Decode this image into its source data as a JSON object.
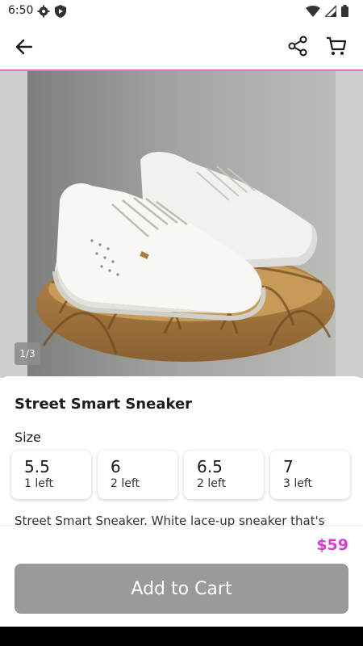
{
  "status_bar": {
    "time": "6:50",
    "left_icons": [
      "gear-icon",
      "shield-icon"
    ],
    "right_icons": [
      "wifi-icon",
      "signal-icon",
      "battery-icon"
    ]
  },
  "app_bar": {
    "back_icon": "arrow-left-icon",
    "share_icon": "share-icon",
    "cart_icon": "cart-icon"
  },
  "gallery": {
    "page_indicator": "1/3",
    "current_image": 1,
    "total_images": 3
  },
  "product": {
    "title": "Street Smart Sneaker",
    "size_label": "Size",
    "sizes": [
      {
        "value": "5.5",
        "stock": "1 left"
      },
      {
        "value": "6",
        "stock": "2 left"
      },
      {
        "value": "6.5",
        "stock": "2 left"
      },
      {
        "value": "7",
        "stock": "3 left"
      }
    ],
    "description": "Street Smart Sneaker. White lace-up sneaker that's"
  },
  "checkout": {
    "price": "$59",
    "add_to_cart_label": "Add to Cart"
  },
  "colors": {
    "accent": "#d93ad1",
    "button_disabled": "#9a9a9a"
  }
}
